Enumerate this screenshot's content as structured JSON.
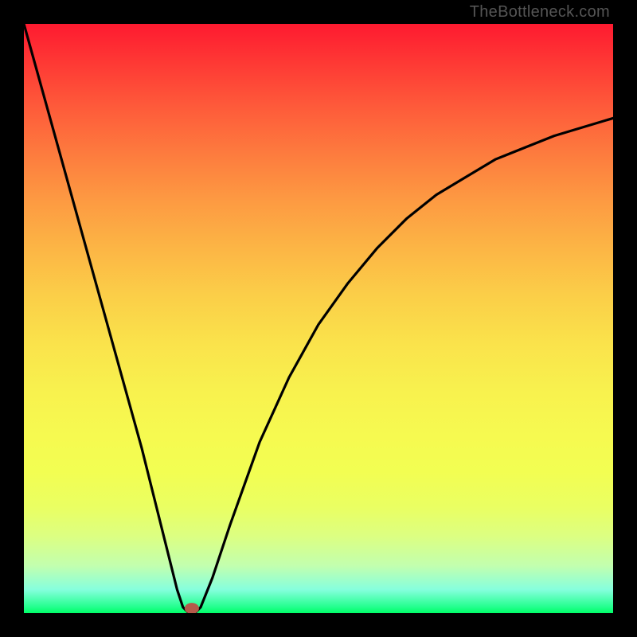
{
  "watermark": "TheBottleneck.com",
  "colors": {
    "frame": "#000000",
    "gradient_top": "#fe1a30",
    "gradient_bottom": "#00ff68",
    "curve": "#000000",
    "marker": "#b55a4a"
  },
  "chart_data": {
    "type": "line",
    "title": "",
    "xlabel": "",
    "ylabel": "",
    "xlim": [
      0,
      100
    ],
    "ylim": [
      0,
      100
    ],
    "grid": false,
    "legend": false,
    "series": [
      {
        "name": "bottleneck-curve",
        "x": [
          0,
          5,
          10,
          15,
          20,
          24,
          26,
          27,
          28,
          29,
          30,
          32,
          35,
          40,
          45,
          50,
          55,
          60,
          65,
          70,
          75,
          80,
          85,
          90,
          95,
          100
        ],
        "values": [
          100,
          82,
          64,
          46,
          28,
          12,
          4,
          1,
          0,
          0,
          1,
          6,
          15,
          29,
          40,
          49,
          56,
          62,
          67,
          71,
          74,
          77,
          79,
          81,
          82.5,
          84
        ]
      }
    ],
    "annotations": [
      {
        "name": "marker",
        "x": 28.5,
        "y": 0.8,
        "shape": "ellipse",
        "color": "#b55a4a"
      }
    ]
  }
}
